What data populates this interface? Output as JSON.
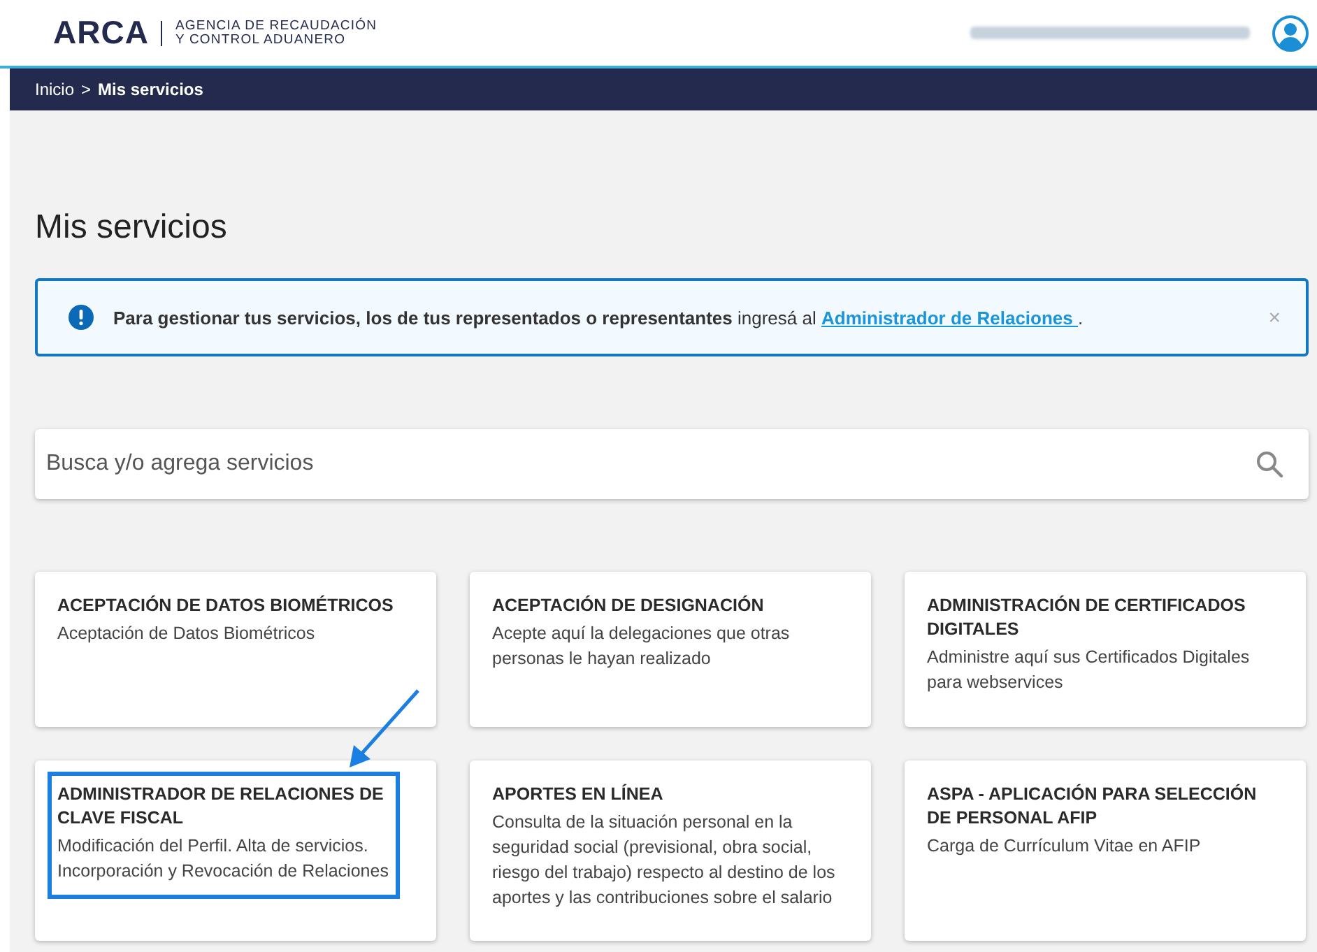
{
  "header": {
    "logo": "ARCA",
    "agency_line_1": "AGENCIA DE RECAUDACIÓN",
    "agency_line_2": "Y CONTROL ADUANERO"
  },
  "breadcrumb": [
    {
      "label": "Inicio",
      "current": false
    },
    {
      "label": "Mis servicios",
      "current": true
    }
  ],
  "breadcrumb_separator": ">",
  "page_title": "Mis servicios",
  "alert": {
    "text": "**Para gestionar tus servicios, los de tus representados o representantes** ingresá al",
    "link": "Administrador de Relaciones ",
    "end": ".",
    "close": "×"
  },
  "search": {
    "placeholder": "Busca y/o agrega servicios"
  },
  "services": [
    {
      "title": "ACEPTACIÓN DE DATOS BIOMÉTRICOS",
      "description": "Aceptación de Datos Biométricos",
      "highlighted": false
    },
    {
      "title": "ACEPTACIÓN DE DESIGNACIÓN",
      "description": "Acepte aquí la delegaciones que otras personas le hayan realizado",
      "highlighted": false
    },
    {
      "title": "ADMINISTRACIÓN DE CERTIFICADOS DIGITALES",
      "description": "Administre aquí sus Certificados Digitales para webservices",
      "highlighted": false
    },
    {
      "title": "ADMINISTRADOR DE RELACIONES DE CLAVE FISCAL",
      "description": "Modificación del Perfil. Alta de servicios. Incorporación y Revocación de Relaciones",
      "highlighted": true
    },
    {
      "title": "APORTES EN LÍNEA",
      "description": "Consulta de la situación personal en la seguridad social (previsional, obra social, riesgo del trabajo) respecto al destino de los aportes y las contribuciones sobre el salario",
      "highlighted": false
    },
    {
      "title": "ASPA - APLICACIÓN PARA SELECCIÓN DE PERSONAL AFIP",
      "description": "Carga de Currículum Vitae en AFIP",
      "highlighted": false
    }
  ]
}
